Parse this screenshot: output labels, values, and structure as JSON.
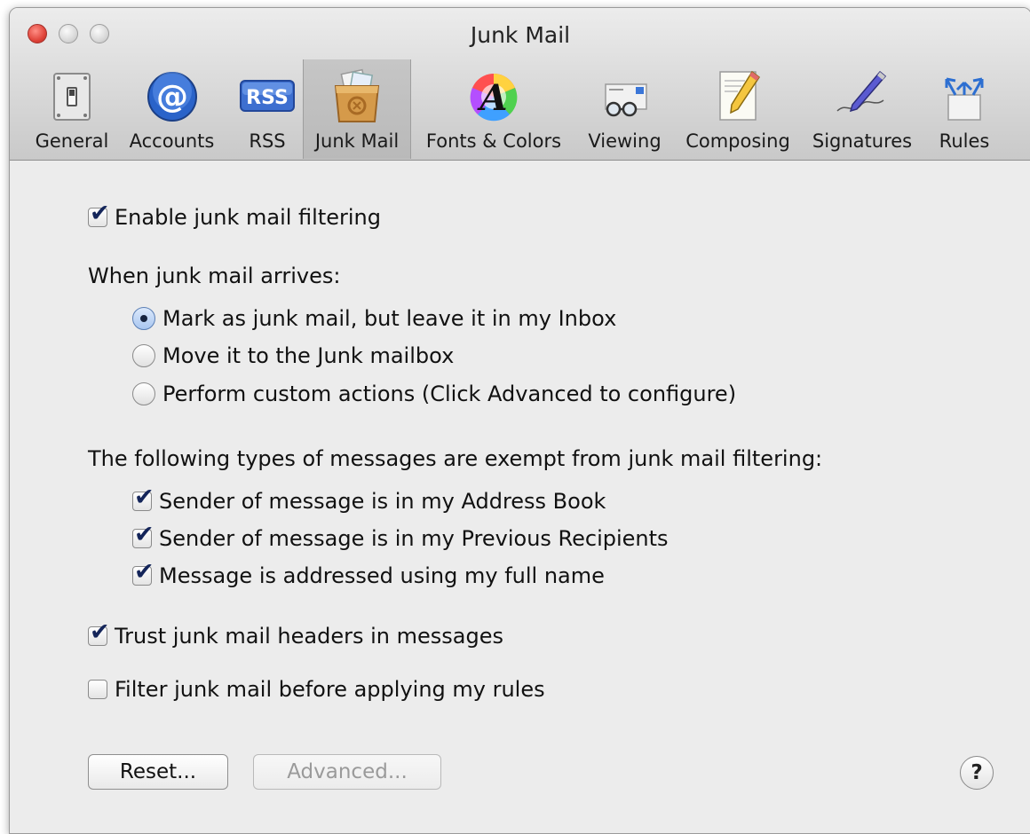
{
  "window": {
    "title": "Junk Mail"
  },
  "toolbar": {
    "items": [
      {
        "label": "General",
        "icon": "general-switch-icon"
      },
      {
        "label": "Accounts",
        "icon": "at-sign-icon"
      },
      {
        "label": "RSS",
        "icon": "rss-icon",
        "icon_text": "RSS"
      },
      {
        "label": "Junk Mail",
        "icon": "junk-mail-bin-icon",
        "active": true
      },
      {
        "label": "Fonts & Colors",
        "icon": "fonts-colors-icon",
        "icon_text": "A"
      },
      {
        "label": "Viewing",
        "icon": "viewing-glasses-icon"
      },
      {
        "label": "Composing",
        "icon": "composing-pencil-icon"
      },
      {
        "label": "Signatures",
        "icon": "signature-pen-icon"
      },
      {
        "label": "Rules",
        "icon": "rules-arrows-icon"
      }
    ]
  },
  "content": {
    "enable_filtering": {
      "label": "Enable junk mail filtering",
      "checked": true
    },
    "arrival_heading": "When junk mail arrives:",
    "arrival_options": [
      {
        "label": "Mark as junk mail, but leave it in my Inbox",
        "selected": true
      },
      {
        "label": "Move it to the Junk mailbox",
        "selected": false
      },
      {
        "label": "Perform custom actions (Click Advanced to configure)",
        "selected": false
      }
    ],
    "exempt_heading": "The following types of messages are exempt from junk mail filtering:",
    "exempt_options": [
      {
        "label": "Sender of message is in my Address Book",
        "checked": true
      },
      {
        "label": "Sender of message is in my Previous Recipients",
        "checked": true
      },
      {
        "label": "Message is addressed using my full name",
        "checked": true
      }
    ],
    "trust_headers": {
      "label": "Trust junk mail headers in messages",
      "checked": true
    },
    "filter_before_rules": {
      "label": "Filter junk mail before applying my rules",
      "checked": false
    }
  },
  "buttons": {
    "reset": "Reset...",
    "advanced": "Advanced...",
    "help": "?"
  },
  "colors": {
    "window_bg": "#ececec",
    "toolbar_active": "#c0c0c0",
    "checkmark": "#14255a",
    "close_button": "#e0443a"
  }
}
